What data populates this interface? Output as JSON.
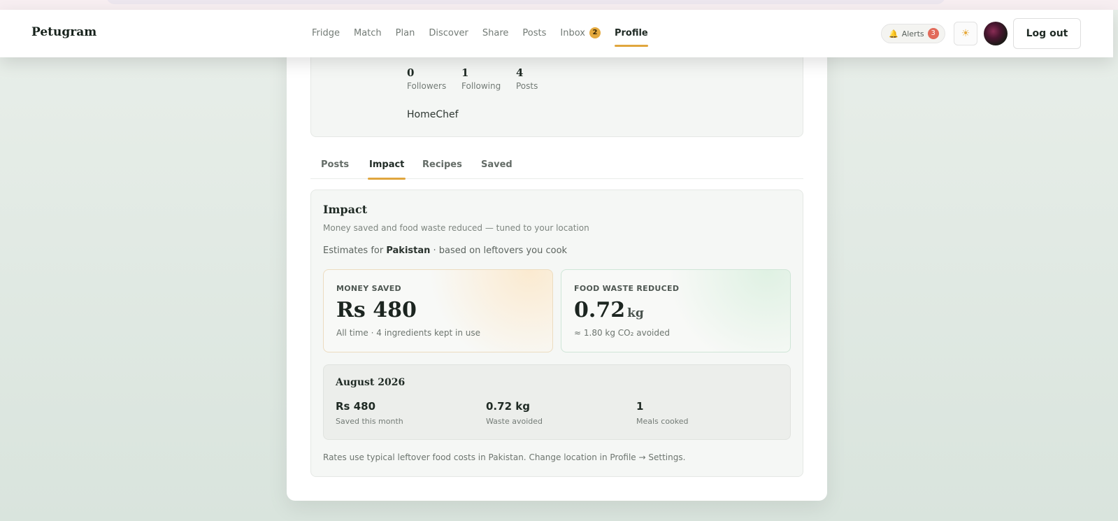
{
  "nav": {
    "brand": "Petugram",
    "links": [
      {
        "label": "Fridge"
      },
      {
        "label": "Match"
      },
      {
        "label": "Plan"
      },
      {
        "label": "Discover"
      },
      {
        "label": "Share"
      },
      {
        "label": "Posts"
      },
      {
        "label": "Inbox",
        "badge": "2"
      },
      {
        "label": "Profile",
        "active": true
      }
    ],
    "alerts_label": "Alerts",
    "alerts_count": "3",
    "theme_icon": "☀",
    "logout_label": "Log out"
  },
  "profile": {
    "stats": [
      {
        "value": "0",
        "label": "Followers"
      },
      {
        "value": "1",
        "label": "Following"
      },
      {
        "value": "4",
        "label": "Posts"
      }
    ],
    "handle": "HomeChef"
  },
  "tabs": [
    {
      "label": "Posts"
    },
    {
      "label": "Impact",
      "active": true
    },
    {
      "label": "Recipes"
    },
    {
      "label": "Saved"
    }
  ],
  "impact": {
    "title": "Impact",
    "subtitle": "Money saved and food waste reduced — tuned to your location",
    "estimate_prefix": "Estimates for",
    "country": "Pakistan",
    "estimate_suffix": "· based on leftovers you cook",
    "money": {
      "label": "MONEY SAVED",
      "value": "Rs 480",
      "note": "All time · 4 ingredients kept in use"
    },
    "waste": {
      "label": "FOOD WASTE REDUCED",
      "value": "0.72",
      "unit": "kg",
      "note": "≈ 1.80 kg CO₂ avoided"
    },
    "month": {
      "title": "August 2026",
      "stats": [
        {
          "value": "Rs 480",
          "label": "Saved this month"
        },
        {
          "value": "0.72 kg",
          "label": "Waste avoided"
        },
        {
          "value": "1",
          "label": "Meals cooked"
        }
      ]
    },
    "footnote": "Rates use typical leftover food costs in Pakistan. Change location in Profile → Settings."
  },
  "colors": {
    "accent": "#e0a63e",
    "alert_badge": "#e26a5a",
    "background": "#e1e9e3"
  }
}
